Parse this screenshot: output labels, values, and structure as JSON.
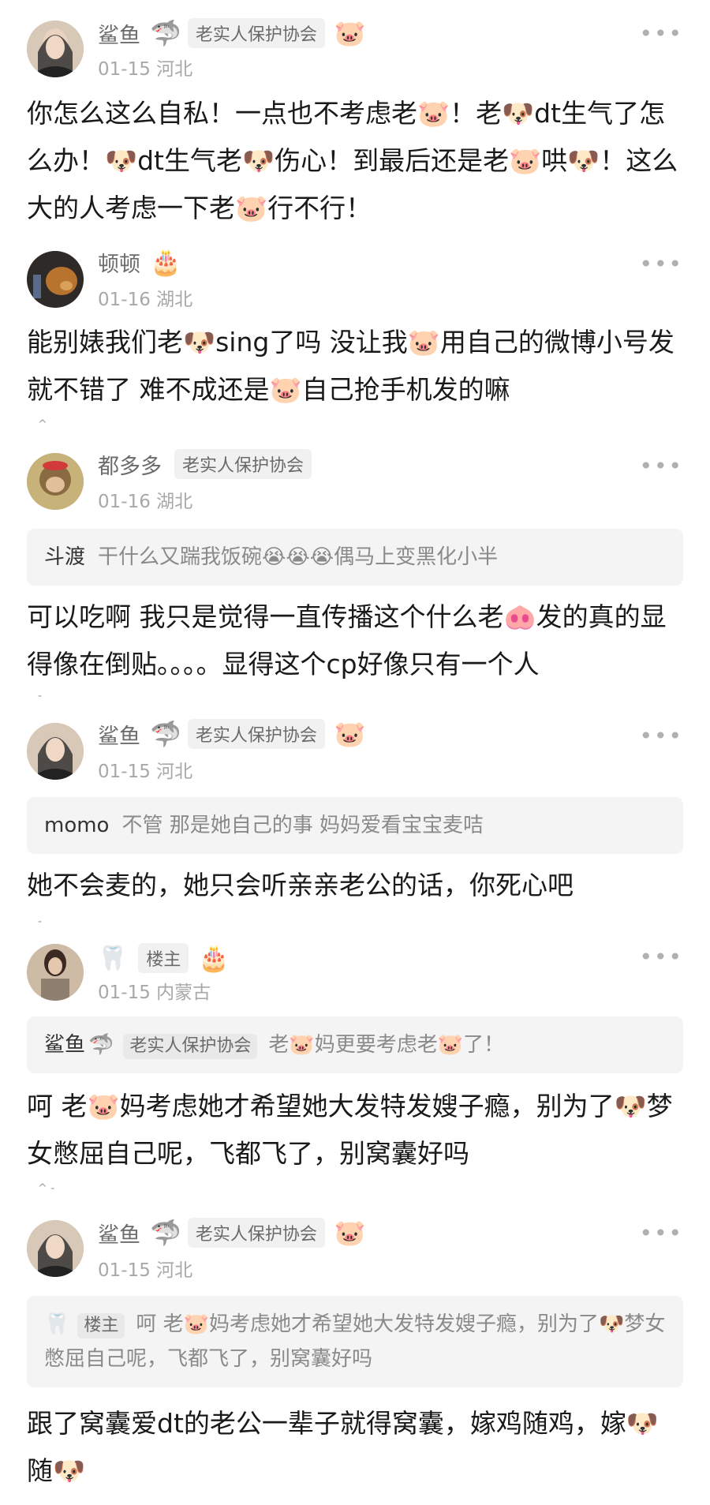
{
  "comments": [
    {
      "name": "鲨鱼",
      "name_emoji": "🦈",
      "badge": "老实人保护协会",
      "deco": "🐷",
      "date": "01-15 河北",
      "more": "•••",
      "body": "你怎么这么自私！一点也不考虑老🐷！老🐶dt生气了怎么办！🐶dt生气老🐶伤心！到最后还是老🐷哄🐶！这么大的人考虑一下老🐷行不行！",
      "avatar_color": "#3a3a3a"
    },
    {
      "name": "顿顿",
      "deco": "🎂",
      "date": "01-16 湖北",
      "more": "•••",
      "body": "能别婊我们老🐶sing了吗 没让我🐷用自己的微博小号发就不错了 难不成还是🐷自己抢手机发的嘛",
      "avatar_color": "#6b4a2f"
    },
    {
      "name": "都多多",
      "badge": "老实人保护协会",
      "date": "01-16 湖北",
      "more": "•••",
      "quote": {
        "name": "斗渡",
        "text": "干什么又踹我饭碗😭😭😭偶马上变黑化小半"
      },
      "body": "可以吃啊 我只是觉得一直传播这个什么老🐽发的真的显得像在倒贴。。。。显得这个cp好像只有一个人",
      "avatar_color": "#b8a06a"
    },
    {
      "name": "鲨鱼",
      "name_emoji": "🦈",
      "badge": "老实人保护协会",
      "deco": "🐷",
      "date": "01-15 河北",
      "more": "•••",
      "quote": {
        "name": "momo",
        "text": "不管 那是她自己的事 妈妈爱看宝宝麦咭"
      },
      "body": "她不会麦的，她只会听亲亲老公的话，你死心吧",
      "avatar_color": "#3a3a3a"
    },
    {
      "name_emoji_before": "🦷",
      "name": "楼主",
      "deco": "🎂",
      "date": "01-15 内蒙古",
      "more": "•••",
      "quote": {
        "name": "鲨鱼",
        "name_emoji": "🦈",
        "badge": "老实人保护协会",
        "text": "老🐷妈更要考虑老🐷了！"
      },
      "body": "呵 老🐷妈考虑她才希望她大发特发嫂子瘾，别为了🐶梦女憋屈自己呢，飞都飞了，别窝囊好吗",
      "avatar_color": "#8a7560"
    },
    {
      "name": "鲨鱼",
      "name_emoji": "🦈",
      "badge": "老实人保护协会",
      "deco": "🐷",
      "date": "01-15 河北",
      "more": "•••",
      "quote": {
        "name_emoji_before": "🦷",
        "badge": "楼主",
        "text": "呵 老🐷妈考虑她才希望她大发特发嫂子瘾，别为了🐶梦女憋屈自己呢，飞都飞了，别窝囊好吗"
      },
      "body": "跟了窝囊爱dt的老公一辈子就得窝囊，嫁鸡随鸡，嫁🐶随🐶",
      "avatar_color": "#3a3a3a"
    }
  ]
}
